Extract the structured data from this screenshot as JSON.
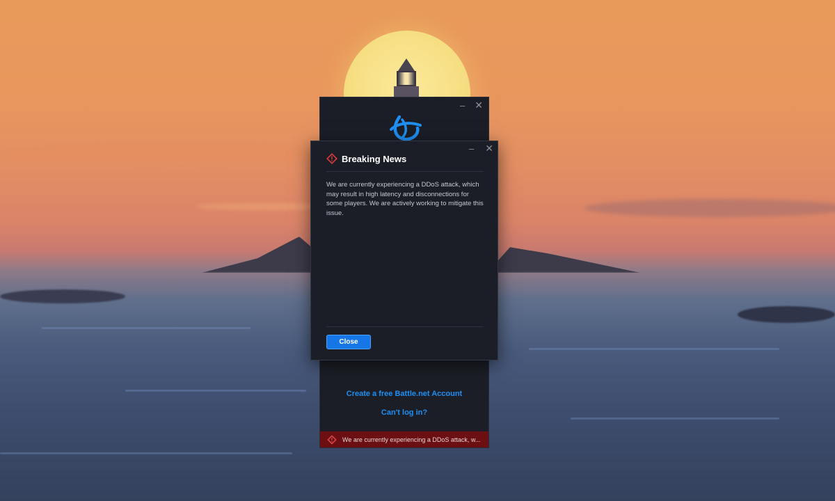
{
  "launcher": {
    "window_controls": {
      "minimize": "–",
      "close": "✕"
    },
    "links": {
      "create_account": "Create a free Battle.net Account",
      "cant_log_in": "Can't log in?"
    },
    "news_bar": {
      "text": "We are currently experiencing a DDoS attack, w..."
    }
  },
  "modal": {
    "window_controls": {
      "minimize": "–",
      "close": "✕"
    },
    "title": "Breaking News",
    "body": "We are currently experiencing a DDoS attack, which may result in high latency and disconnections for some players. We are actively working to mitigate this issue.",
    "close_label": "Close"
  },
  "colors": {
    "accent_blue": "#1676e8",
    "link_blue": "#1f8ff2",
    "alert_red": "#b01b22",
    "news_bar_red": "#6b0f12",
    "panel_bg": "#1b1e26"
  },
  "icons": {
    "logo": "battlenet-logo-icon",
    "alert": "alert-diamond-icon"
  }
}
